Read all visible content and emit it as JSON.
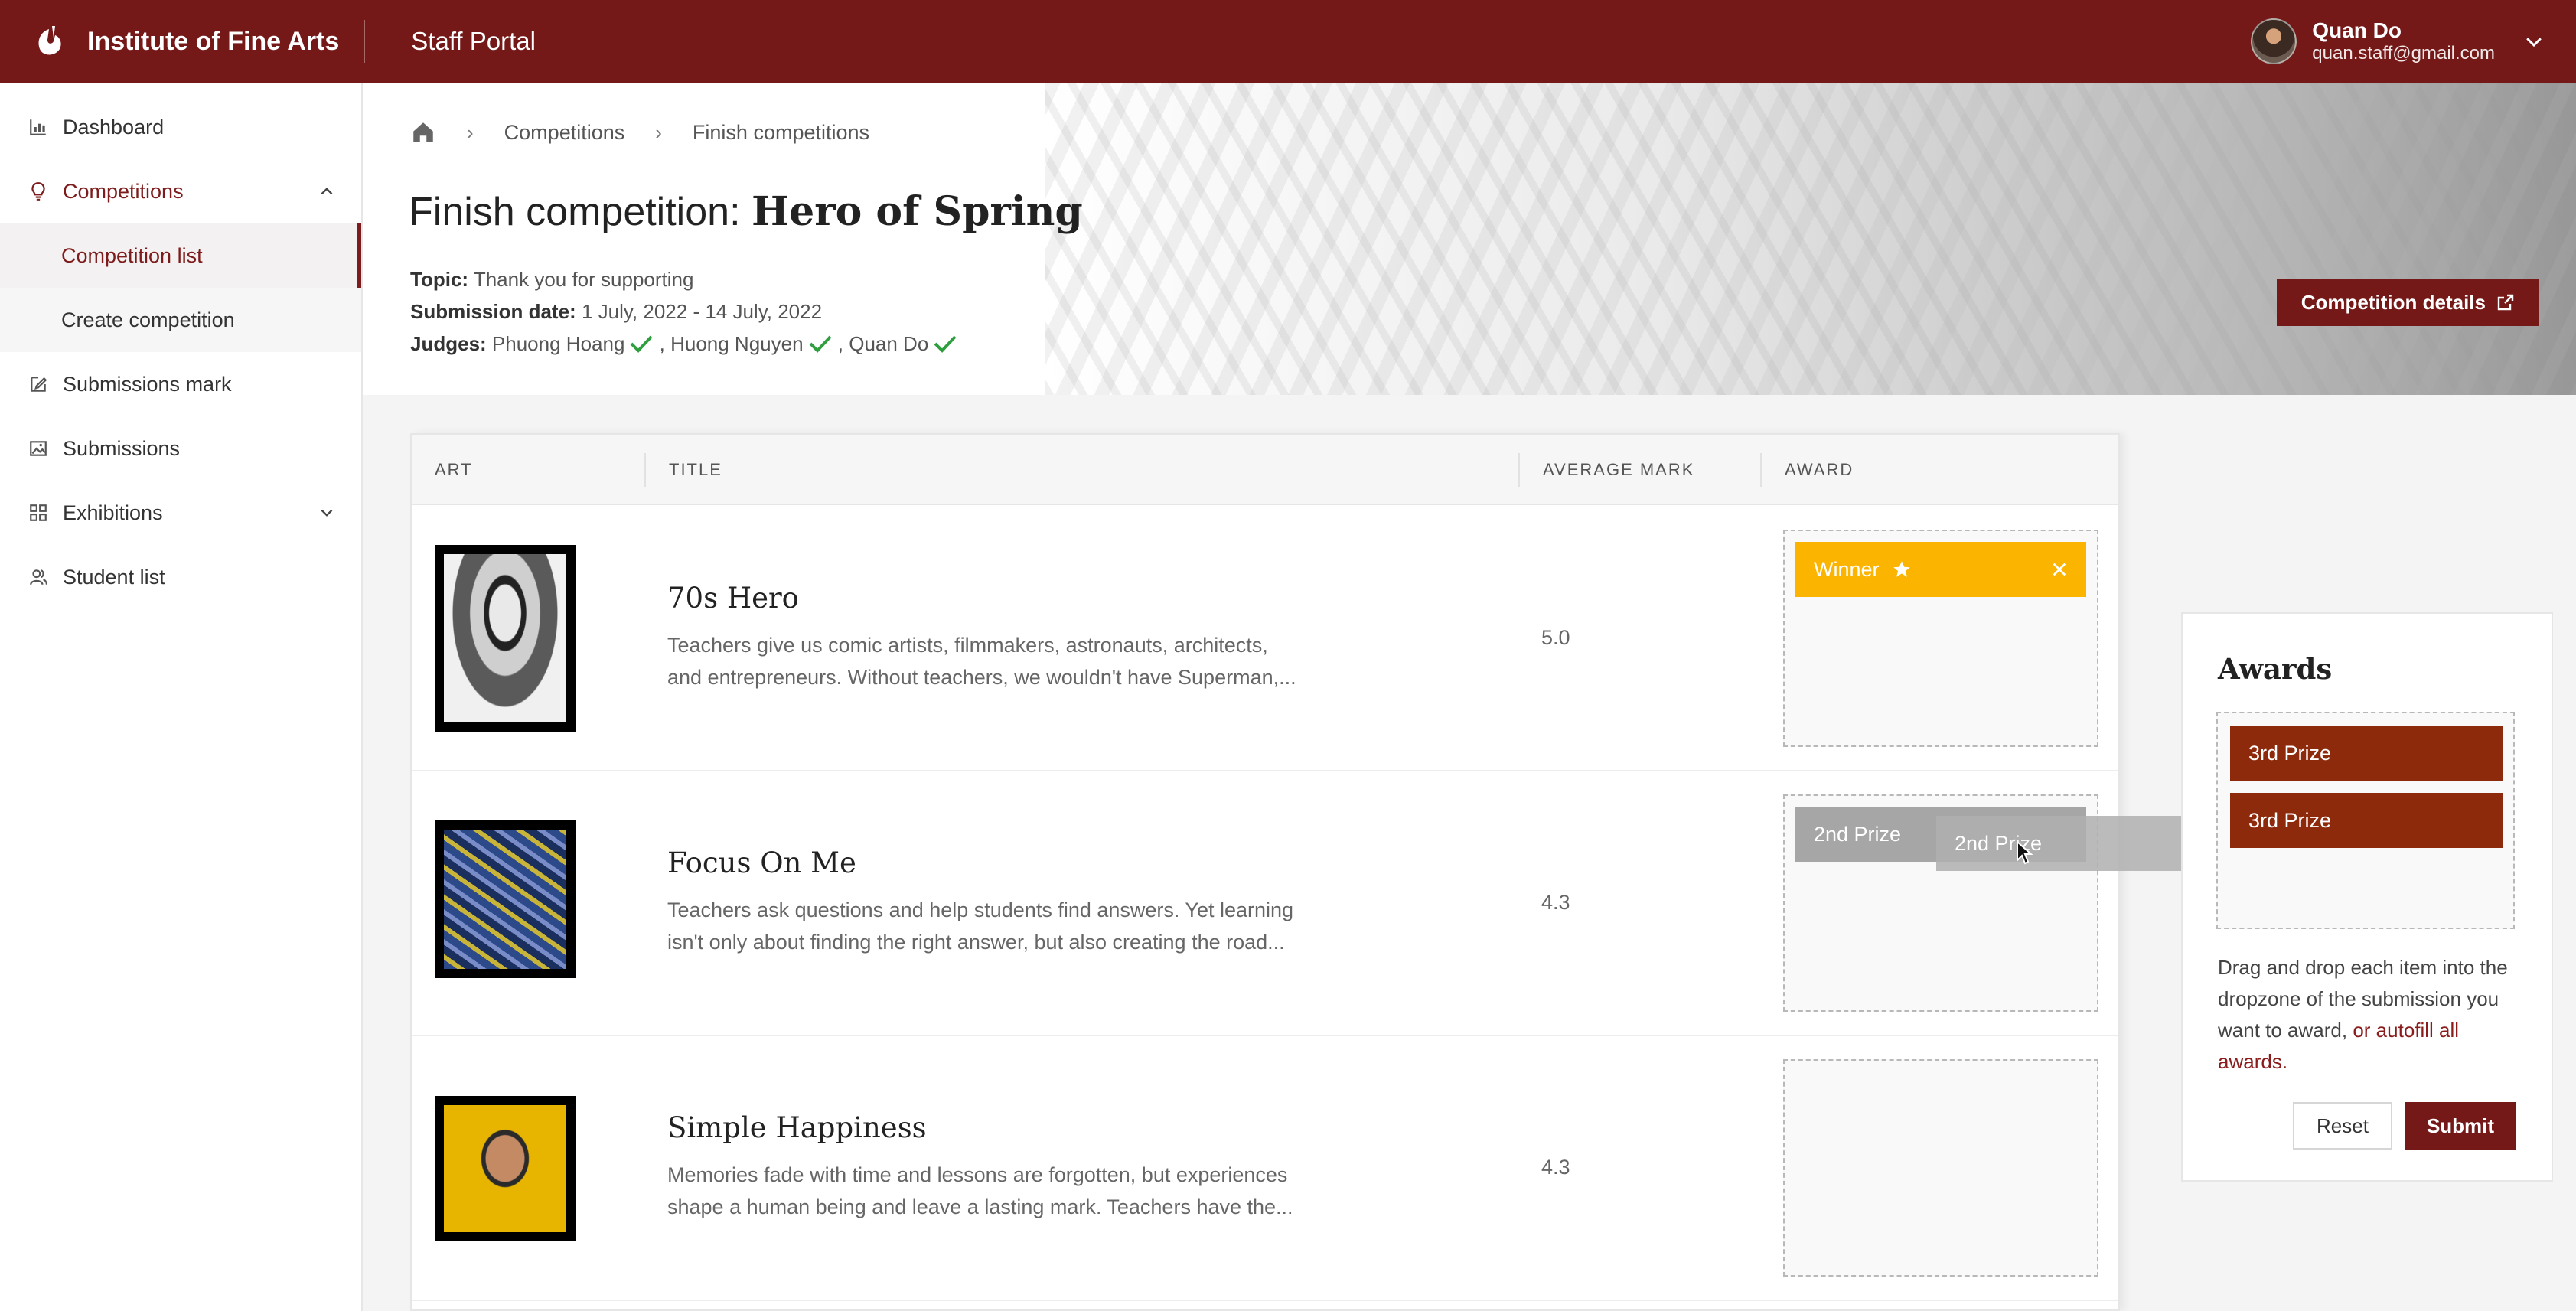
{
  "header": {
    "brand": "Institute of Fine Arts",
    "portal": "Staff Portal",
    "user_name": "Quan Do",
    "user_email": "quan.staff@gmail.com"
  },
  "sidebar": {
    "items": [
      {
        "label": "Dashboard",
        "icon": "chart-icon"
      },
      {
        "label": "Competitions",
        "icon": "lightbulb-icon"
      },
      {
        "label": "Competition list"
      },
      {
        "label": "Create competition"
      },
      {
        "label": "Submissions mark",
        "icon": "edit-icon"
      },
      {
        "label": "Submissions",
        "icon": "image-icon"
      },
      {
        "label": "Exhibitions",
        "icon": "grid-icon"
      },
      {
        "label": "Student list",
        "icon": "users-icon"
      }
    ]
  },
  "breadcrumb": {
    "items": [
      "Competitions",
      "Finish competitions"
    ]
  },
  "page": {
    "title_prefix": "Finish competition:",
    "title_name": "Hero of Spring",
    "topic_label": "Topic:",
    "topic": "Thank you for supporting",
    "date_label": "Submission date:",
    "date": "1 July, 2022 - 14 July, 2022",
    "judges_label": "Judges:",
    "judges": [
      "Phuong Hoang",
      ", Huong Nguyen",
      ", Quan Do"
    ],
    "details_button": "Competition details"
  },
  "table": {
    "headers": [
      "ART",
      "TITLE",
      "AVERAGE MARK",
      "AWARD"
    ],
    "rows": [
      {
        "title": "70s Hero",
        "desc1": "Teachers give us comic artists, filmmakers, astronauts, architects,",
        "desc2": "and entrepreneurs. Without teachers, we wouldn't have Superman,...",
        "mark": "5.0",
        "award": "Winner"
      },
      {
        "title": "Focus On Me",
        "desc1": "Teachers ask questions and help students find answers. Yet learning",
        "desc2": "isn't only about finding the right answer, but also creating the road...",
        "mark": "4.3",
        "award": "2nd Prize"
      },
      {
        "title": "Simple Happiness",
        "desc1": "Memories fade with time and lessons are forgotten, but experiences",
        "desc2": "shape a human being and leave a lasting mark. Teachers have the...",
        "mark": "4.3",
        "award": ""
      }
    ]
  },
  "drag_ghost": "2nd Prize",
  "awards": {
    "title": "Awards",
    "items": [
      "3rd Prize",
      "3rd Prize"
    ],
    "hint": "Drag and drop each item into the dropzone of the submission you want to award,",
    "hint_link": "or autofill all awards.",
    "reset": "Reset",
    "submit": "Submit"
  },
  "colors": {
    "brand": "#741818",
    "winner": "#fbb400",
    "prize3": "#8e2a0c",
    "check": "#2e9e3e"
  }
}
